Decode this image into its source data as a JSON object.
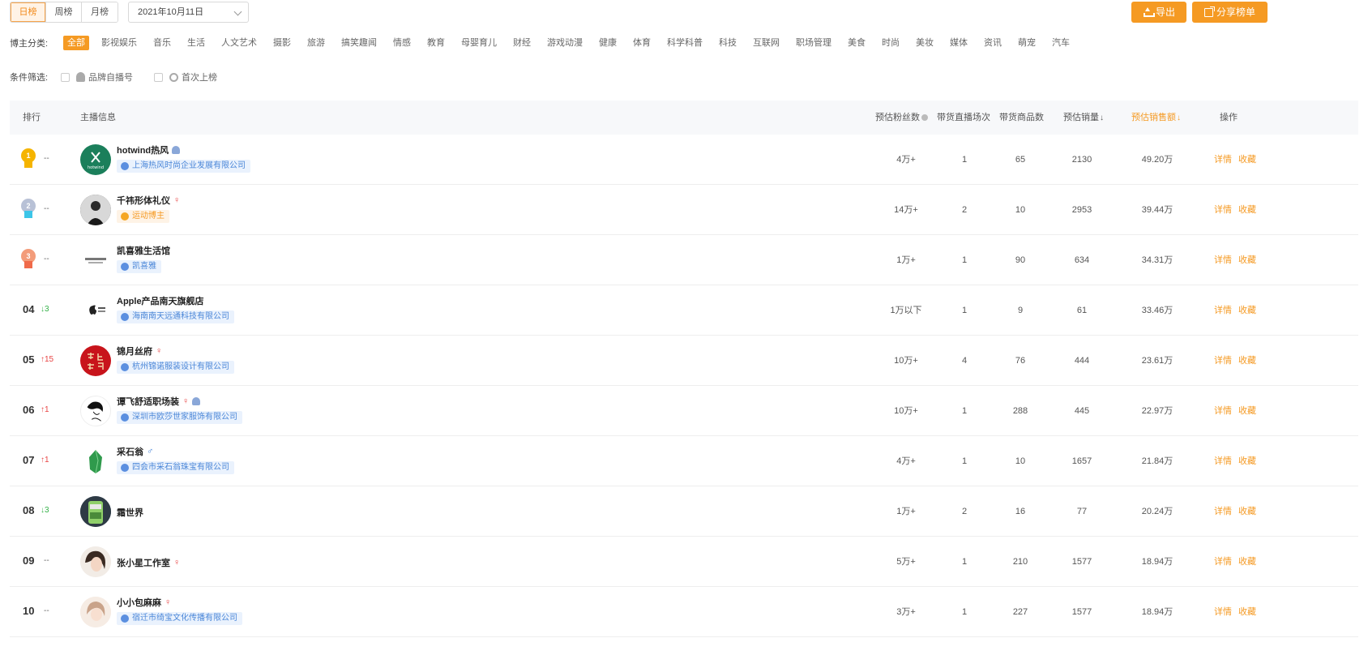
{
  "tabs": [
    "日榜",
    "周榜",
    "月榜"
  ],
  "date": "2021年10月11日",
  "export_label": "导出",
  "share_label": "分享榜单",
  "category_label": "博主分类:",
  "categories": [
    "全部",
    "影视娱乐",
    "音乐",
    "生活",
    "人文艺术",
    "摄影",
    "旅游",
    "搞笑趣闻",
    "情感",
    "教育",
    "母婴育儿",
    "财经",
    "游戏动漫",
    "健康",
    "体育",
    "科学科普",
    "科技",
    "互联网",
    "职场管理",
    "美食",
    "时尚",
    "美妆",
    "媒体",
    "资讯",
    "萌宠",
    "汽车"
  ],
  "filter_label": "条件筛选:",
  "filters": [
    "品牌自播号",
    "首次上榜"
  ],
  "columns": {
    "rank": "排行",
    "info": "主播信息",
    "fans": "预估粉丝数",
    "live": "带货直播场次",
    "goods": "带货商品数",
    "volume": "预估销量",
    "amount": "预估销售额",
    "action": "操作"
  },
  "actions": [
    "详情",
    "收藏"
  ],
  "rows": [
    {
      "rank": "1",
      "change": "--",
      "name": "hotwind热风",
      "tag": "上海热风时尚企业发展有限公司",
      "fans": "4万+",
      "live": "1",
      "goods": "65",
      "volume": "2130",
      "amount": "49.20万"
    },
    {
      "rank": "2",
      "change": "--",
      "name": "千祎形体礼仪",
      "tag": "运动博主",
      "fans": "14万+",
      "live": "2",
      "goods": "10",
      "volume": "2953",
      "amount": "39.44万"
    },
    {
      "rank": "3",
      "change": "--",
      "name": "凯喜雅生活馆",
      "tag": "凯喜雅",
      "fans": "1万+",
      "live": "1",
      "goods": "90",
      "volume": "634",
      "amount": "34.31万"
    },
    {
      "rank": "04",
      "change": "3",
      "name": "Apple产品南天旗舰店",
      "tag": "海南南天远通科技有限公司",
      "fans": "1万以下",
      "live": "1",
      "goods": "9",
      "volume": "61",
      "amount": "33.46万"
    },
    {
      "rank": "05",
      "change": "15",
      "name": "锦月丝府",
      "tag": "杭州锦诺服装设计有限公司",
      "fans": "10万+",
      "live": "4",
      "goods": "76",
      "volume": "444",
      "amount": "23.61万"
    },
    {
      "rank": "06",
      "change": "1",
      "name": "谭飞舒适职场装",
      "tag": "深圳市欧莎世家服饰有限公司",
      "fans": "10万+",
      "live": "1",
      "goods": "288",
      "volume": "445",
      "amount": "22.97万"
    },
    {
      "rank": "07",
      "change": "1",
      "name": "采石翁",
      "tag": "四会市采石翁珠宝有限公司",
      "fans": "4万+",
      "live": "1",
      "goods": "10",
      "volume": "1657",
      "amount": "21.84万"
    },
    {
      "rank": "08",
      "change": "3",
      "name": "霜世界",
      "tag": "",
      "fans": "1万+",
      "live": "2",
      "goods": "16",
      "volume": "77",
      "amount": "20.24万"
    },
    {
      "rank": "09",
      "change": "--",
      "name": "张小星工作室",
      "tag": "",
      "fans": "5万+",
      "live": "1",
      "goods": "210",
      "volume": "1577",
      "amount": "18.94万"
    },
    {
      "rank": "10",
      "change": "--",
      "name": "小小包麻麻",
      "tag": "宿迁市绮宝文化传播有限公司",
      "fans": "3万+",
      "live": "1",
      "goods": "227",
      "volume": "1577",
      "amount": "18.94万"
    }
  ],
  "brand_color": "#f59a23"
}
